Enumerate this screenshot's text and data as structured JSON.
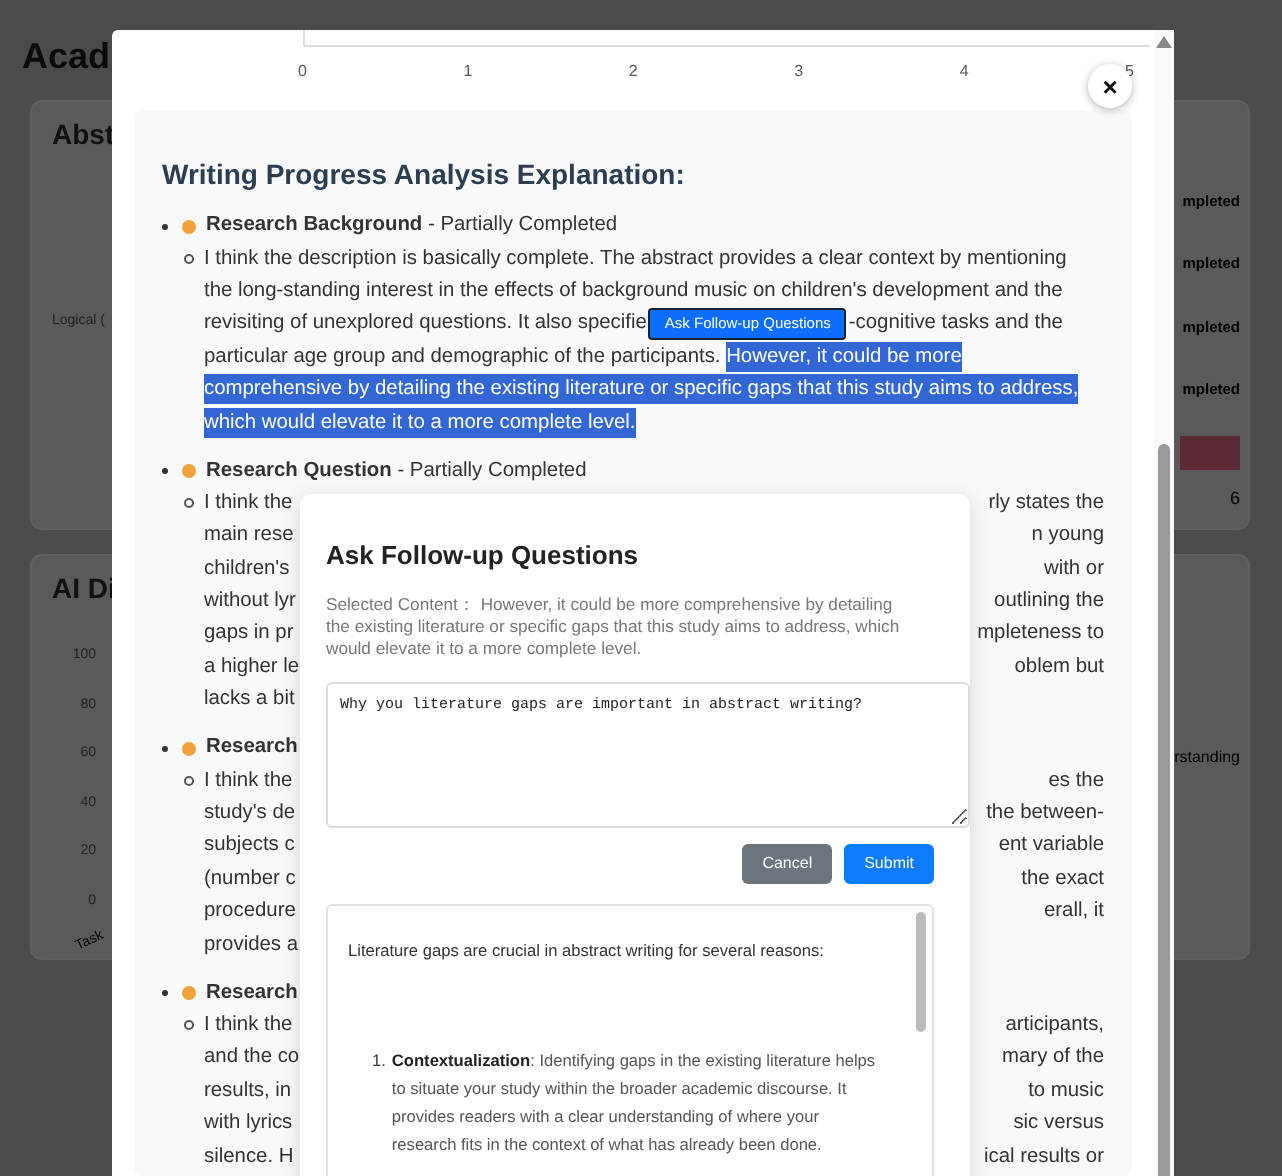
{
  "page": {
    "title": "Acad",
    "cards": [
      {
        "title": "Abst",
        "left_texts": [
          "Logical ("
        ],
        "right_texts": [
          "mpleted",
          "mpleted",
          "mpleted",
          "mpleted"
        ],
        "right_number": "6"
      },
      {
        "title": "AI Di",
        "y_ticks": [
          "100",
          "80",
          "60",
          "40",
          "20",
          "0"
        ],
        "x_label": "Task",
        "right_texts": [
          "rstanding"
        ]
      }
    ]
  },
  "modal": {
    "axis_ticks": [
      "0",
      "1",
      "2",
      "3",
      "4",
      "5"
    ],
    "close": "×",
    "heading": "Writing Progress Analysis Explanation:",
    "items": [
      {
        "name": "Research Background",
        "status": " - Partially Completed",
        "color": "#f0a33c",
        "lines": [
          [
            {
              "kind": "text",
              "text": "I think the description is basically complete. The abstract provides a clear context by mentioning",
              "selected": false
            }
          ],
          [
            {
              "kind": "text",
              "text": "the long-standing interest in the effects of background music on children's development and the",
              "selected": false
            }
          ],
          [
            {
              "kind": "text",
              "text": "revisiting of unexplored questions. It also specifie",
              "selected": false
            },
            {
              "kind": "button",
              "text": "Ask Follow-up Questions"
            },
            {
              "kind": "text",
              "text": "-cognitive tasks and the",
              "selected": false
            }
          ],
          [
            {
              "kind": "text",
              "text": "particular age group and demographic of the participants. ",
              "selected": false
            },
            {
              "kind": "text",
              "text": "However, it could be more",
              "selected": true
            }
          ],
          [
            {
              "kind": "text",
              "text": "comprehensive by detailing the existing literature or specific gaps that this study aims to address,",
              "selected": true
            }
          ],
          [
            {
              "kind": "text",
              "text": "which would elevate it to a more complete level.",
              "selected": true
            }
          ]
        ]
      },
      {
        "name": "Research Question",
        "status": " - Partially Completed",
        "color": "#f0a33c",
        "covered_lines": [
          [
            "I think the",
            "rly states the"
          ],
          [
            "main rese",
            "n young"
          ],
          [
            "children's",
            "with or"
          ],
          [
            "without lyr",
            "outlining the"
          ],
          [
            "gaps in pr",
            "mpleteness to"
          ],
          [
            "a higher le",
            "oblem but"
          ],
          [
            "lacks a bit"
          ]
        ]
      },
      {
        "name": "Research",
        "color": "#f0a33c",
        "covered_lines": [
          [
            "I think the",
            "es the"
          ],
          [
            "study's de",
            "the between-"
          ],
          [
            "subjects c",
            "ent variable"
          ],
          [
            "(number c",
            "the exact"
          ],
          [
            "procedure",
            "erall, it"
          ],
          [
            "provides a"
          ]
        ]
      },
      {
        "name": "Research",
        "color": "#f0a33c",
        "covered_lines": [
          [
            "I think the",
            "articipants,"
          ],
          [
            "and the co",
            "mary of the"
          ],
          [
            "results, in",
            "to music"
          ],
          [
            "with lyrics",
            "sic versus"
          ],
          [
            "silence. H",
            "ical results or"
          ]
        ]
      }
    ]
  },
  "dialog": {
    "title": "Ask Follow-up Questions",
    "selected_content": "Selected Content：  However, it could be more comprehensive by detailing the existing literature or specific gaps that this study aims to address, which would elevate it to a more complete level.",
    "question": "Why you literature gaps are important in abstract writing?",
    "buttons": [
      {
        "label": "Cancel",
        "kind": "secondary"
      },
      {
        "label": "Submit",
        "kind": "primary"
      }
    ],
    "answer": {
      "intro": "Literature gaps are crucial in abstract writing for several reasons:",
      "points": [
        {
          "number": "1.",
          "title": "Contextualization",
          "text": ": Identifying gaps in the existing literature helps to situate your study within the broader academic discourse. It provides readers with a clear understanding of where your research fits in the context of what has already been done."
        }
      ]
    }
  }
}
